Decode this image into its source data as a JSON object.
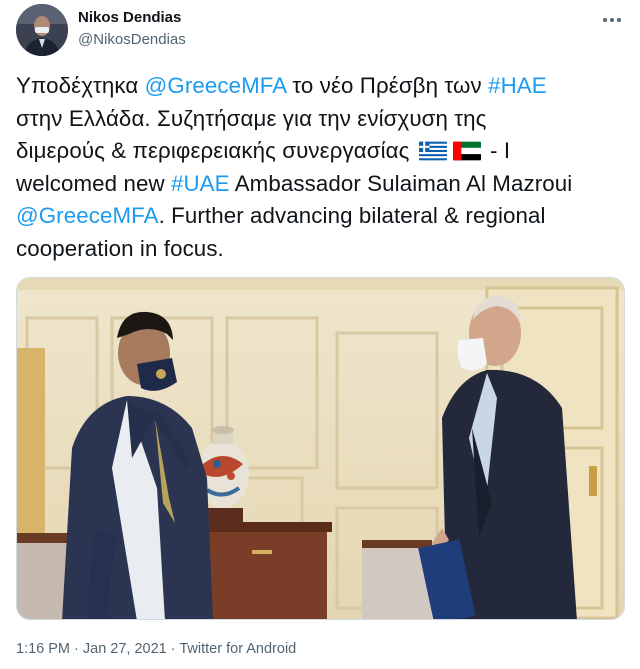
{
  "author": {
    "name": "Nikos Dendias",
    "handle": "@NikosDendias"
  },
  "tweet": {
    "lines": [
      [
        {
          "t": "Υποδέχτηκα ",
          "link": false
        },
        {
          "t": "@GreeceMFA",
          "link": true
        },
        {
          "t": " το νέο Πρέσβη των ",
          "link": false
        },
        {
          "t": "#ΗΑΕ",
          "link": true
        }
      ],
      [
        {
          "t": "στην Ελλάδα. Συζητήσαμε για την ενίσχυση της",
          "link": false
        }
      ],
      [
        {
          "t": "διμερούς & περιφερειακής συνεργασίας ",
          "link": false
        },
        {
          "flag": "greece-flag-icon"
        },
        {
          "flag": "uae-flag-icon"
        },
        {
          "t": " - I",
          "link": false
        }
      ],
      [
        {
          "t": "welcomed new ",
          "link": false
        },
        {
          "t": "#UAE",
          "link": true
        },
        {
          "t": " Ambassador Sulaiman Al Mazroui",
          "link": false
        }
      ],
      [
        {
          "t": "@GreeceMFA",
          "link": true
        },
        {
          "t": ". Further advancing bilateral & regional",
          "link": false
        }
      ],
      [
        {
          "t": "cooperation in focus.",
          "link": false
        }
      ]
    ]
  },
  "footer": {
    "time": "1:16 PM",
    "sep1": " · ",
    "date": "Jan 27, 2021",
    "sep2": " · ",
    "source": "Twitter for Android"
  },
  "colors": {
    "link": "#1d9bf0",
    "text": "#0f1419",
    "secondary": "#536471"
  },
  "icons": [
    "more-options-icon",
    "greece-flag-icon",
    "uae-flag-icon"
  ]
}
